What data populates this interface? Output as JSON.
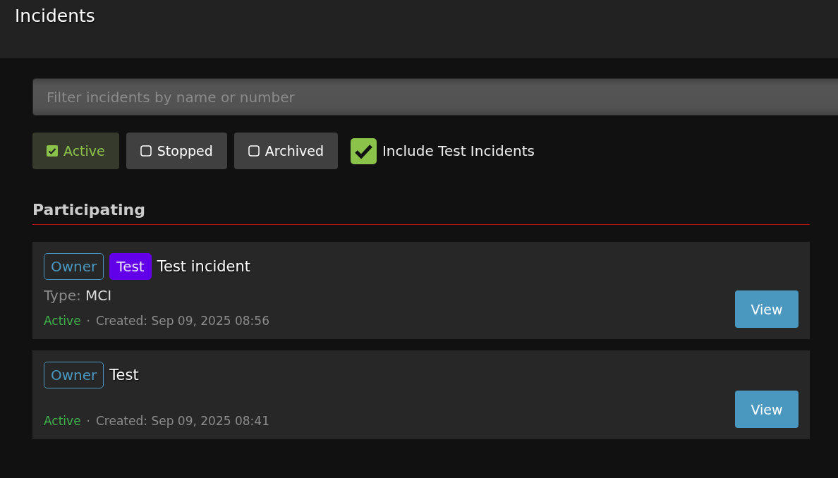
{
  "header": {
    "title": "Incidents"
  },
  "search": {
    "placeholder": "Filter incidents by name or number"
  },
  "filters": [
    {
      "label": "Active",
      "selected": true
    },
    {
      "label": "Stopped",
      "selected": false
    },
    {
      "label": "Archived",
      "selected": false
    }
  ],
  "include_test": {
    "label": "Include Test Incidents",
    "checked": true
  },
  "section": {
    "title": "Participating"
  },
  "incidents": [
    {
      "badges": [
        {
          "kind": "owner",
          "label": "Owner"
        },
        {
          "kind": "test",
          "label": "Test"
        }
      ],
      "title": "Test incident",
      "type_label": "Type:",
      "type_value": "MCI",
      "status": "Active",
      "separator": "·",
      "created": "Created: Sep 09, 2025 08:56",
      "button": "View"
    },
    {
      "badges": [
        {
          "kind": "owner",
          "label": "Owner"
        }
      ],
      "title": "Test",
      "status": "Active",
      "separator": "·",
      "created": "Created: Sep 09, 2025 08:41",
      "button": "View"
    }
  ]
}
